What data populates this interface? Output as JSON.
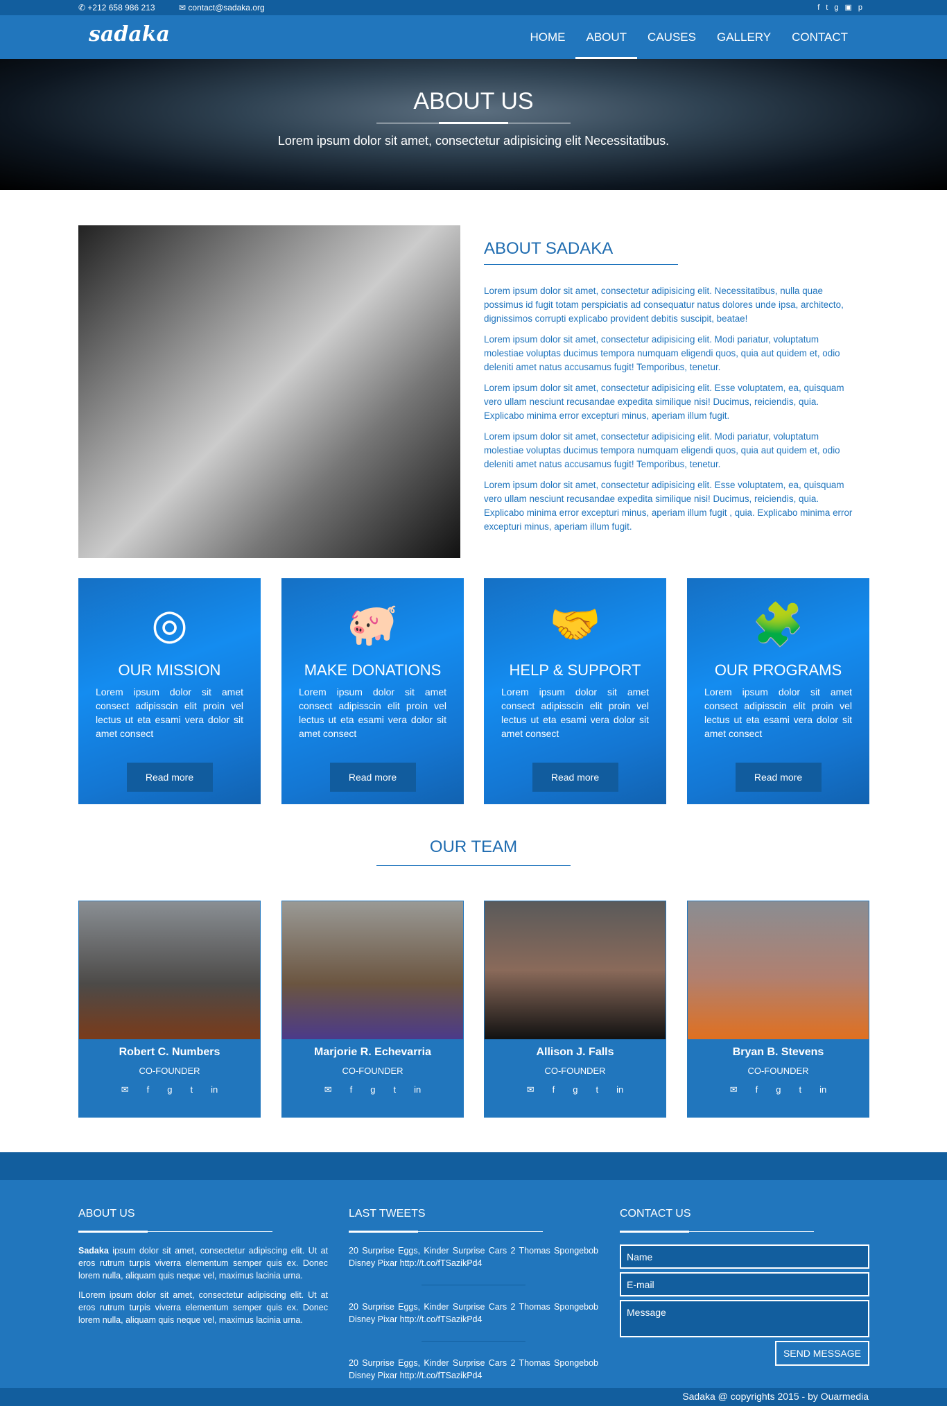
{
  "topbar": {
    "phone": "+212 658 986 213",
    "email": "contact@sadaka.org",
    "social": [
      "facebook",
      "twitter",
      "google-plus",
      "youtube",
      "pinterest"
    ]
  },
  "nav": {
    "logo": "sadaka",
    "items": [
      "HOME",
      "ABOUT",
      "CAUSES",
      "GALLERY",
      "CONTACT"
    ],
    "active": "ABOUT"
  },
  "hero": {
    "title": "ABOUT US",
    "subtitle": "Lorem ipsum dolor sit amet, consectetur adipisicing elit Necessitatibus."
  },
  "about": {
    "title": "ABOUT SADAKA",
    "paragraphs": [
      "Lorem ipsum dolor sit amet, consectetur adipisicing elit. Necessitatibus, nulla quae possimus id fugit totam perspiciatis ad consequatur natus dolores unde ipsa, architecto, dignissimos corrupti explicabo provident debitis suscipit, beatae!",
      "Lorem ipsum dolor sit amet, consectetur adipisicing elit. Modi pariatur, voluptatum molestiae voluptas ducimus tempora numquam eligendi quos, quia aut quidem et, odio deleniti amet natus accusamus fugit! Temporibus, tenetur.",
      "Lorem ipsum dolor sit amet, consectetur adipisicing elit. Esse voluptatem, ea, quisquam vero ullam nesciunt recusandae expedita similique nisi! Ducimus, reiciendis, quia. Explicabo minima error excepturi minus, aperiam illum fugit.",
      "Lorem ipsum dolor sit amet, consectetur adipisicing elit. Modi pariatur, voluptatum molestiae voluptas ducimus tempora numquam eligendi quos, quia aut quidem et, odio deleniti amet natus accusamus fugit! Temporibus, tenetur.",
      "Lorem ipsum dolor sit amet, consectetur adipisicing elit. Esse voluptatem, ea, quisquam vero ullam nesciunt recusandae expedita similique nisi! Ducimus, reiciendis, quia. Explicabo minima error excepturi minus, aperiam illum fugit , quia. Explicabo minima error excepturi minus, aperiam illum fugit."
    ]
  },
  "cards": [
    {
      "title": "OUR MISSION",
      "icon": "target-icon",
      "text": "Lorem ipsum dolor sit amet consect adipisscin elit proin vel lectus ut eta esami vera dolor sit amet consect",
      "button": "Read more"
    },
    {
      "title": "MAKE DONATIONS",
      "icon": "piggy-bank-icon",
      "text": "Lorem ipsum dolor sit amet consect adipisscin elit proin vel lectus ut eta esami vera dolor sit amet consect",
      "button": "Read more"
    },
    {
      "title": "HELP & SUPPORT",
      "icon": "handshake-icon",
      "text": "Lorem ipsum dolor sit amet consect adipisscin elit proin vel lectus ut eta esami vera dolor sit amet consect",
      "button": "Read more"
    },
    {
      "title": "OUR PROGRAMS",
      "icon": "puzzle-icon",
      "text": "Lorem ipsum dolor sit amet consect adipisscin elit proin vel lectus ut eta esami vera dolor sit amet consect",
      "button": "Read more"
    }
  ],
  "team": {
    "title": "OUR TEAM",
    "members": [
      {
        "name": "Robert C. Numbers",
        "role": "CO-FOUNDER"
      },
      {
        "name": "Marjorie R. Echevarria",
        "role": "CO-FOUNDER"
      },
      {
        "name": "Allison J. Falls",
        "role": "CO-FOUNDER"
      },
      {
        "name": "Bryan B. Stevens",
        "role": "CO-FOUNDER"
      }
    ]
  },
  "footer": {
    "about": {
      "title": "ABOUT US",
      "bold": "Sadaka",
      "p1": " ipsum dolor sit amet, consectetur adipiscing elit. Ut at eros rutrum turpis viverra elementum semper quis ex. Donec lorem nulla, aliquam quis neque vel, maximus lacinia urna.",
      "p2": "ILorem ipsum dolor sit amet, consectetur adipiscing elit. Ut at eros rutrum turpis viverra elementum semper quis ex. Donec lorem nulla, aliquam quis neque vel, maximus lacinia urna."
    },
    "tweets": {
      "title": "LAST TWEETS",
      "items": [
        "20 Surprise Eggs, Kinder Surprise Cars 2 Thomas Spongebob Disney Pixar http://t.co/fTSazikPd4",
        "20 Surprise Eggs, Kinder Surprise Cars 2 Thomas Spongebob Disney Pixar http://t.co/fTSazikPd4",
        "20 Surprise Eggs, Kinder Surprise Cars 2 Thomas Spongebob Disney Pixar http://t.co/fTSazikPd4"
      ]
    },
    "contact": {
      "title": "CONTACT US",
      "name_placeholder": "Name",
      "email_placeholder": "E-mail",
      "message_placeholder": "Message",
      "send": "SEND MESSAGE"
    },
    "copyright": "Sadaka @ copyrights 2015 - by Ouarmedia"
  }
}
